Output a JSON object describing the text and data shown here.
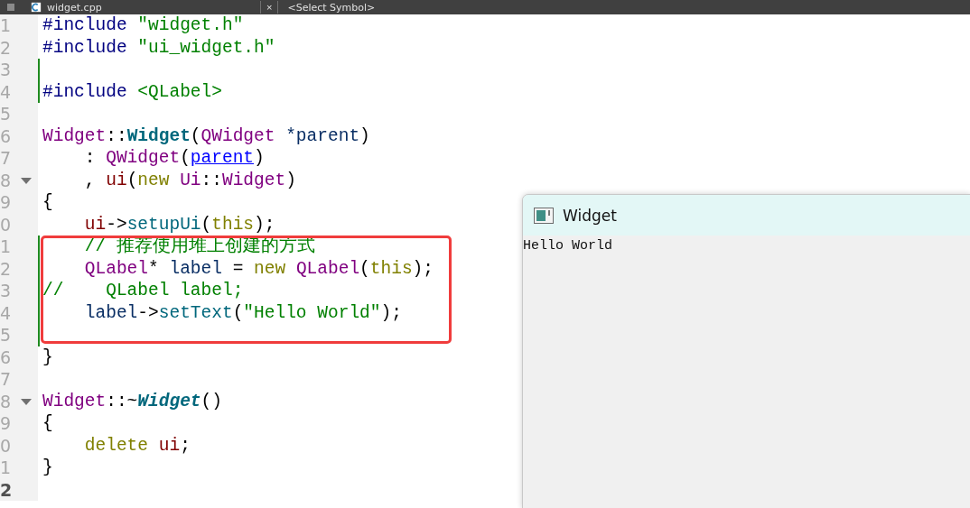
{
  "tab_bar": {
    "file_name": "widget.cpp",
    "close": "×",
    "symbol_selector": "<Select Symbol>"
  },
  "lines": [
    {
      "number": "1",
      "changed": false,
      "fold": false,
      "current": false,
      "tokens": [
        {
          "kind": "preproc",
          "text": "#include "
        },
        {
          "kind": "string",
          "text": "\"widget.h\""
        }
      ]
    },
    {
      "number": "2",
      "changed": false,
      "fold": false,
      "current": false,
      "tokens": [
        {
          "kind": "preproc",
          "text": "#include "
        },
        {
          "kind": "string",
          "text": "\"ui_widget.h\""
        }
      ]
    },
    {
      "number": "3",
      "changed": true,
      "fold": false,
      "current": false
    },
    {
      "number": "4",
      "changed": true,
      "fold": false,
      "current": false,
      "tokens": [
        {
          "kind": "preproc",
          "text": "#include "
        },
        {
          "kind": "string",
          "text": "<QLabel>"
        }
      ]
    },
    {
      "number": "5",
      "changed": false,
      "fold": false,
      "current": false
    },
    {
      "number": "6",
      "changed": false,
      "fold": false,
      "current": false,
      "tokens": [
        {
          "kind": "type",
          "text": "Widget"
        },
        {
          "kind": "plain",
          "text": "::"
        },
        {
          "kind": "function",
          "text": "Widget"
        },
        {
          "kind": "plain",
          "text": "("
        },
        {
          "kind": "type",
          "text": "QWidget"
        },
        {
          "kind": "param",
          "text": " *parent"
        },
        {
          "kind": "plain",
          "text": ")"
        }
      ]
    },
    {
      "number": "7",
      "changed": false,
      "fold": false,
      "current": false,
      "tokens": [
        {
          "kind": "plain",
          "text": "    : "
        },
        {
          "kind": "type",
          "text": "QWidget"
        },
        {
          "kind": "plain",
          "text": "("
        },
        {
          "kind": "link",
          "text": "parent"
        },
        {
          "kind": "plain",
          "text": ")"
        }
      ]
    },
    {
      "number": "8",
      "changed": false,
      "fold": true,
      "current": false,
      "tokens": [
        {
          "kind": "plain",
          "text": "    , "
        },
        {
          "kind": "member",
          "text": "ui"
        },
        {
          "kind": "plain",
          "text": "("
        },
        {
          "kind": "keyword",
          "text": "new "
        },
        {
          "kind": "type",
          "text": "Ui"
        },
        {
          "kind": "plain",
          "text": "::"
        },
        {
          "kind": "type",
          "text": "Widget"
        },
        {
          "kind": "plain",
          "text": ")"
        }
      ]
    },
    {
      "number": "9",
      "changed": false,
      "fold": false,
      "current": false,
      "tokens": [
        {
          "kind": "plain",
          "text": "{"
        }
      ]
    },
    {
      "number": "0",
      "changed": false,
      "fold": false,
      "current": false,
      "tokens": [
        {
          "kind": "member",
          "text": "    ui"
        },
        {
          "kind": "plain",
          "text": "->"
        },
        {
          "kind": "method",
          "text": "setupUi"
        },
        {
          "kind": "plain",
          "text": "("
        },
        {
          "kind": "keyword",
          "text": "this"
        },
        {
          "kind": "plain",
          "text": ");"
        }
      ]
    },
    {
      "number": "1",
      "changed": true,
      "fold": false,
      "current": false,
      "tokens": [
        {
          "kind": "comment",
          "text": "    // 推荐使用堆上创建的方式"
        }
      ]
    },
    {
      "number": "2",
      "changed": true,
      "fold": false,
      "current": false,
      "tokens": [
        {
          "kind": "type",
          "text": "    QLabel"
        },
        {
          "kind": "plain",
          "text": "* "
        },
        {
          "kind": "param",
          "text": "label"
        },
        {
          "kind": "plain",
          "text": " = "
        },
        {
          "kind": "keyword",
          "text": "new "
        },
        {
          "kind": "type",
          "text": "QLabel"
        },
        {
          "kind": "plain",
          "text": "("
        },
        {
          "kind": "keyword",
          "text": "this"
        },
        {
          "kind": "plain",
          "text": ");"
        }
      ]
    },
    {
      "number": "3",
      "changed": true,
      "fold": false,
      "current": false,
      "tokens": [
        {
          "kind": "comment",
          "text": "//    QLabel label;"
        }
      ]
    },
    {
      "number": "4",
      "changed": true,
      "fold": false,
      "current": false,
      "tokens": [
        {
          "kind": "param",
          "text": "    label"
        },
        {
          "kind": "plain",
          "text": "->"
        },
        {
          "kind": "method",
          "text": "setText"
        },
        {
          "kind": "plain",
          "text": "("
        },
        {
          "kind": "string",
          "text": "\"Hello World\""
        },
        {
          "kind": "plain",
          "text": ");"
        }
      ]
    },
    {
      "number": "5",
      "changed": true,
      "fold": false,
      "current": false
    },
    {
      "number": "6",
      "changed": false,
      "fold": false,
      "current": false,
      "tokens": [
        {
          "kind": "plain",
          "text": "}"
        }
      ]
    },
    {
      "number": "7",
      "changed": false,
      "fold": false,
      "current": false
    },
    {
      "number": "8",
      "changed": false,
      "fold": true,
      "current": false,
      "tokens": [
        {
          "kind": "type",
          "text": "Widget"
        },
        {
          "kind": "plain",
          "text": "::~"
        },
        {
          "kind": "destructor",
          "text": "Widget"
        },
        {
          "kind": "plain",
          "text": "()"
        }
      ]
    },
    {
      "number": "9",
      "changed": false,
      "fold": false,
      "current": false,
      "tokens": [
        {
          "kind": "plain",
          "text": "{"
        }
      ]
    },
    {
      "number": "0",
      "changed": false,
      "fold": false,
      "current": false,
      "tokens": [
        {
          "kind": "keyword",
          "text": "    delete "
        },
        {
          "kind": "member",
          "text": "ui"
        },
        {
          "kind": "plain",
          "text": ";"
        }
      ]
    },
    {
      "number": "1",
      "changed": false,
      "fold": false,
      "current": false,
      "tokens": [
        {
          "kind": "plain",
          "text": "}"
        }
      ]
    },
    {
      "number": "2",
      "changed": false,
      "fold": false,
      "current": true
    }
  ],
  "app_window": {
    "title": "Widget",
    "label": "Hello World"
  }
}
